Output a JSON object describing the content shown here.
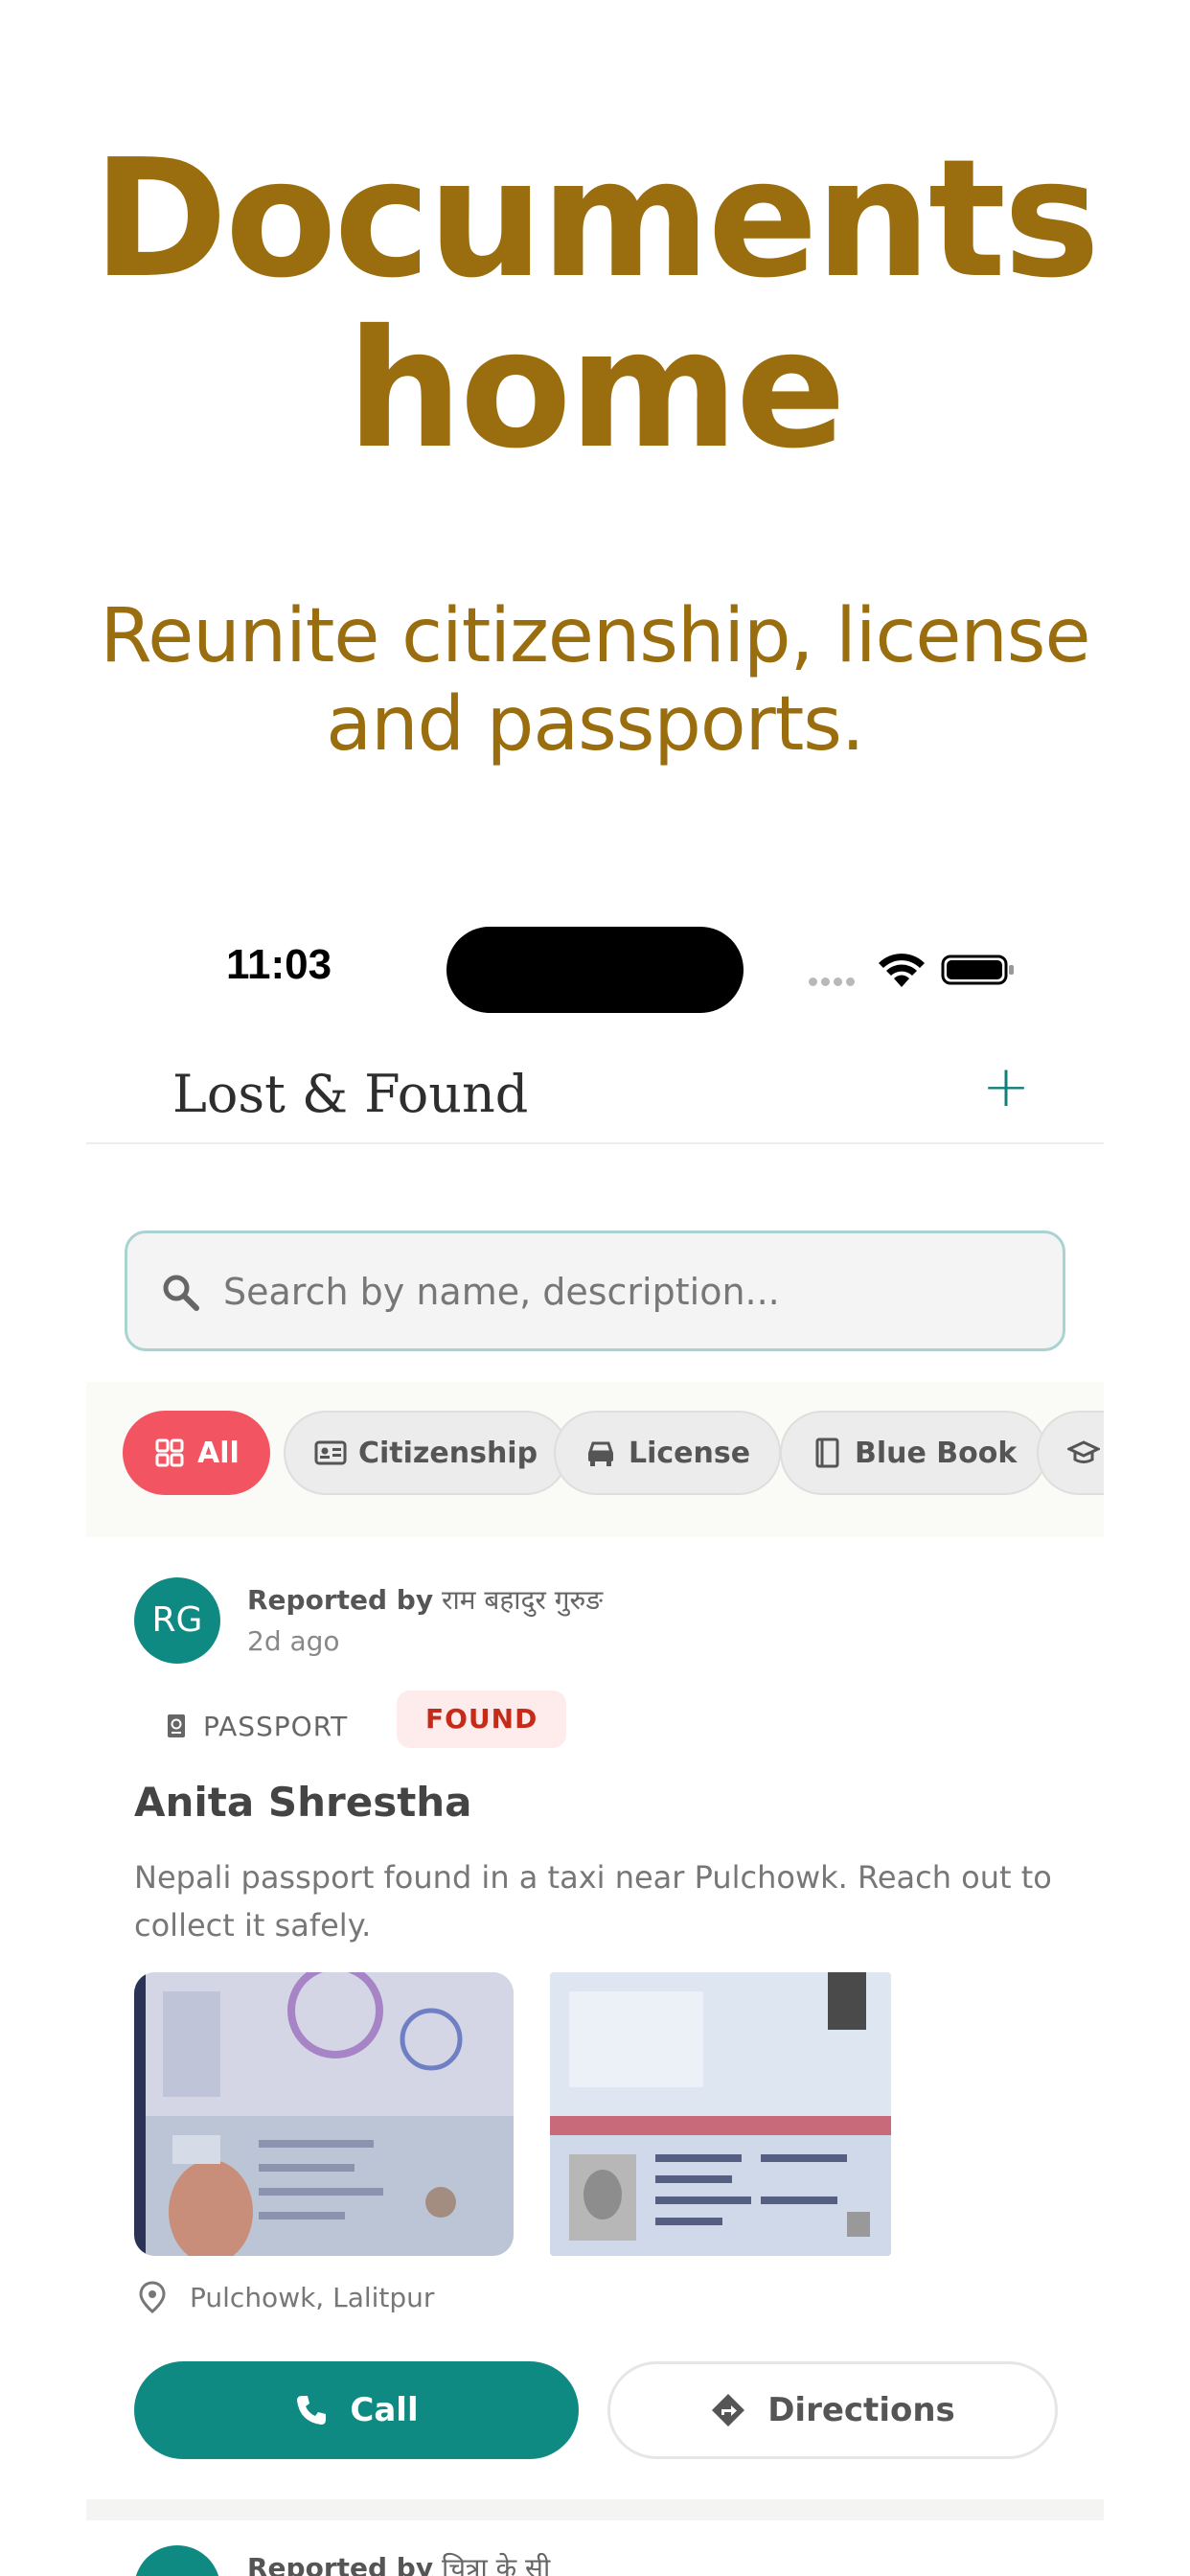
{
  "hero": {
    "title_line1": "Documents",
    "title_line2": "home",
    "subtitle_line1": "Reunite citizenship, license",
    "subtitle_line2": "and passports."
  },
  "status_bar": {
    "time": "11:03"
  },
  "header": {
    "title": "Lost & Found",
    "add_label": "+"
  },
  "search": {
    "placeholder": "Search by name, description..."
  },
  "filters": [
    {
      "label": "All",
      "icon": "grid-icon",
      "active": true
    },
    {
      "label": "Citizenship",
      "icon": "id-card-icon",
      "active": false
    },
    {
      "label": "License",
      "icon": "car-icon",
      "active": false
    },
    {
      "label": "Blue Book",
      "icon": "book-icon",
      "active": false
    },
    {
      "label": "",
      "icon": "graduation-cap-icon",
      "active": false
    }
  ],
  "card": {
    "avatar_initials": "RG",
    "reported_prefix": "Reported by",
    "reporter": "राम बहादुर गुरुङ",
    "time_ago": "2d ago",
    "doc_type": "PASSPORT",
    "status": "FOUND",
    "name": "Anita Shrestha",
    "description": "Nepali passport found in a taxi near Pulchowk. Reach out to collect it safely.",
    "location": "Pulchowk, Lalitpur",
    "call_label": "Call",
    "directions_label": "Directions"
  },
  "next_card": {
    "reported_prefix": "Reported by",
    "reporter": "चित्रा के सी"
  },
  "colors": {
    "accent": "#0f8a82",
    "hero": "#9a6e0e",
    "active_chip": "#f35461",
    "found_badge": "#c62b1a"
  }
}
